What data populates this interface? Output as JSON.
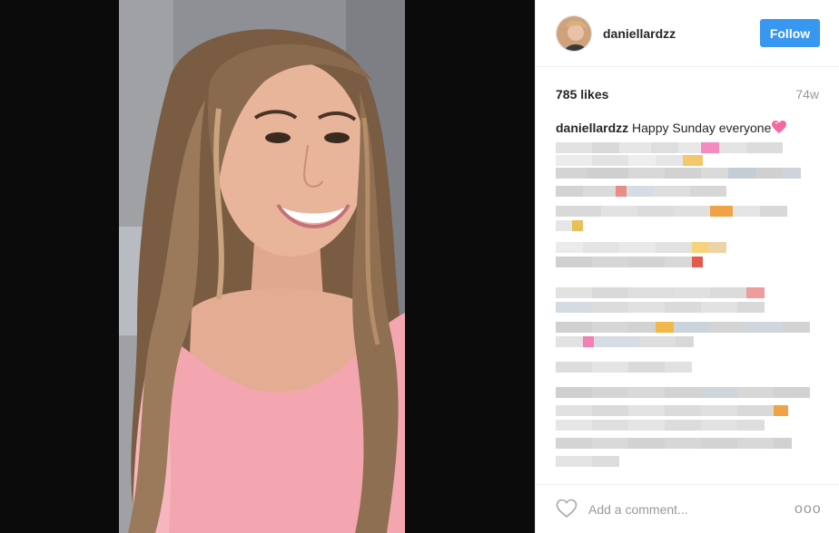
{
  "post": {
    "username": "daniellardzz",
    "follow_label": "Follow",
    "likes": "785 likes",
    "age": "74w",
    "caption_user": "daniellardzz",
    "caption_text": "Happy Sunday everyone",
    "caption_emoji": "pink-heart-emoji",
    "comment_placeholder": "Add a comment...",
    "more_label": "ooo"
  },
  "colors": {
    "accent": "#3897f0",
    "muted": "#999999",
    "divider": "#efefef",
    "text": "#262626",
    "top_pink": "#f4a6b0"
  }
}
